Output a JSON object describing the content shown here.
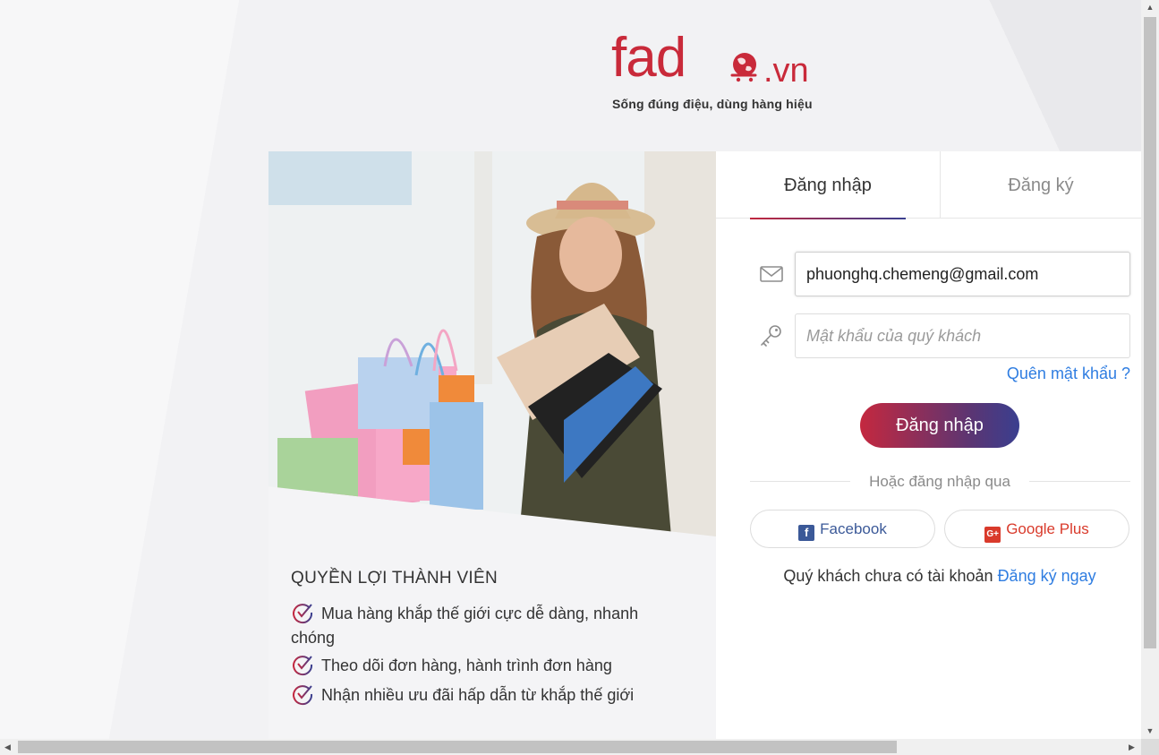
{
  "logo": {
    "brand": "fad",
    "domain": ".vn",
    "slogan": "Sống đúng điệu, dùng hàng hiệu"
  },
  "benefits": {
    "title": "QUYỀN LỢI THÀNH VIÊN",
    "items": [
      "Mua hàng khắp thế giới cực dễ dàng, nhanh chóng",
      "Theo dõi đơn hàng, hành trình đơn hàng",
      "Nhận nhiều ưu đãi hấp dẫn từ khắp thế giới"
    ]
  },
  "tabs": {
    "login": "Đăng nhập",
    "register": "Đăng ký"
  },
  "form": {
    "email_value": "phuonghq.chemeng@gmail.com",
    "password_placeholder": "Mật khẩu của quý khách",
    "forgot_label": "Quên mật khẩu ?",
    "submit_label": "Đăng nhập",
    "or_label": "Hoặc đăng nhập qua",
    "facebook_label": "Facebook",
    "google_label": "Google Plus",
    "no_account_text": "Quý khách chưa có tài khoản",
    "register_now_label": "Đăng ký ngay"
  },
  "icons": {
    "email": "envelope-icon",
    "password": "key-icon",
    "check": "check-circle-icon",
    "facebook": "facebook-icon",
    "google": "google-plus-icon"
  },
  "colors": {
    "brand_red": "#c92a3a",
    "gradient_start": "#c4283f",
    "gradient_end": "#3a3f8f",
    "link_blue": "#2f7de1",
    "facebook_blue": "#3b5998",
    "google_red": "#d93a2b"
  }
}
